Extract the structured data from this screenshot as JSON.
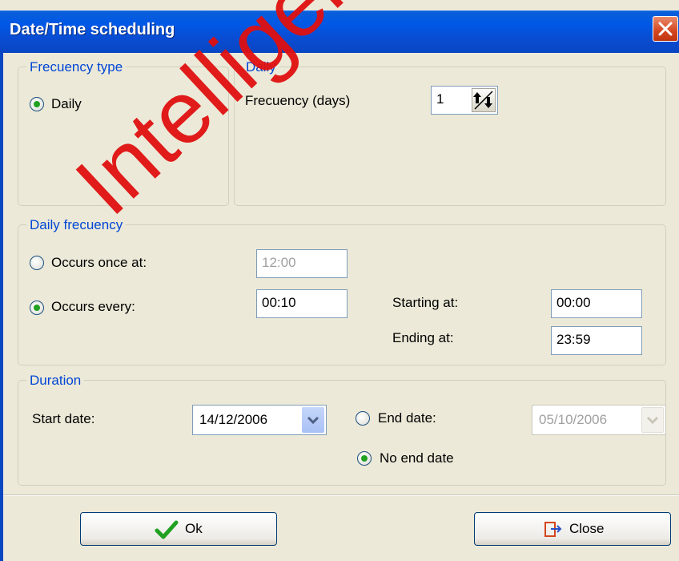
{
  "window": {
    "title": "Date/Time scheduling"
  },
  "frequency_type": {
    "legend": "Frecuency type",
    "options": [
      {
        "label": "Daily",
        "selected": true
      }
    ]
  },
  "daily": {
    "legend": "Daily",
    "frequency_label": "Frecuency (days)",
    "frequency_value": "1"
  },
  "daily_frequency": {
    "legend": "Daily frecuency",
    "occurs_once_label": "Occurs once at:",
    "occurs_once_value": "12:00",
    "occurs_every_label": "Occurs every:",
    "occurs_every_value": "00:10",
    "starting_label": "Starting at:",
    "starting_value": "00:00",
    "ending_label": "Ending at:",
    "ending_value": "23:59",
    "selected": "occurs_every"
  },
  "duration": {
    "legend": "Duration",
    "start_date_label": "Start date:",
    "start_date_value": "14/12/2006",
    "end_date_label": "End date:",
    "end_date_value": "05/10/2006",
    "no_end_date_label": "No end date",
    "selected": "no_end_date"
  },
  "buttons": {
    "ok_label": "Ok",
    "close_label": "Close"
  },
  "watermark": "Intelligent Se",
  "colors": {
    "title_bar": "#0058e6",
    "legend_text": "#0046d5",
    "close_icon": "#d4461e",
    "check": "#21a121",
    "watermark": "#e01010"
  }
}
